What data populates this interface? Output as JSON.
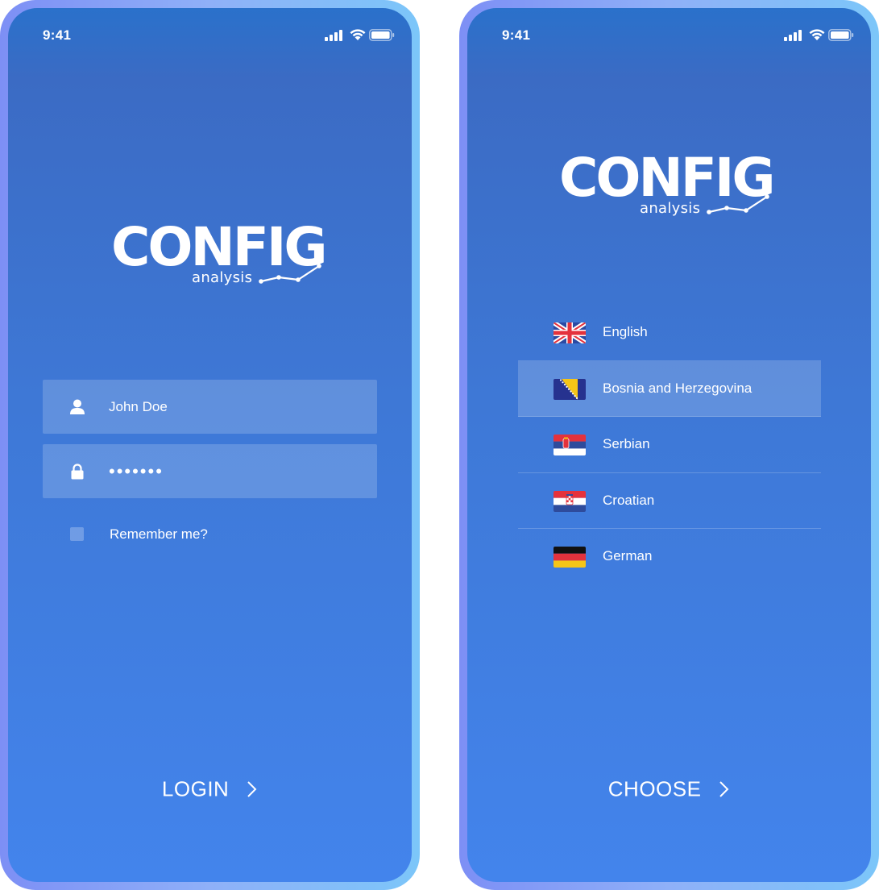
{
  "status_bar": {
    "time": "9:41"
  },
  "logo": {
    "word": "CONFIG",
    "sub": "analysis"
  },
  "login": {
    "username_value": "John Doe",
    "password_value": "•••••••",
    "remember_label": "Remember me?",
    "cta_label": "LOGIN"
  },
  "language": {
    "items": [
      {
        "label": "English",
        "flag": "uk-flag-icon",
        "selected": false
      },
      {
        "label": "Bosnia and Herzegovina",
        "flag": "bosnia-flag-icon",
        "selected": true
      },
      {
        "label": "Serbian",
        "flag": "serbia-flag-icon",
        "selected": false
      },
      {
        "label": "Croatian",
        "flag": "croatia-flag-icon",
        "selected": false
      },
      {
        "label": "German",
        "flag": "germany-flag-icon",
        "selected": false
      }
    ],
    "cta_label": "CHOOSE"
  },
  "colors": {
    "frame_left": "#7d8ff5",
    "frame_right": "#7cc6f9",
    "screen_top": "#2a71cb",
    "screen_bottom": "#4384ec"
  }
}
